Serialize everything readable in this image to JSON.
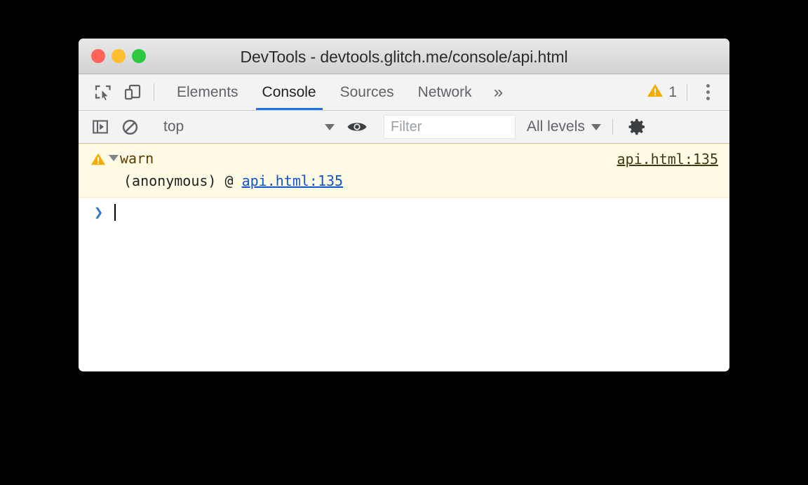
{
  "window": {
    "title": "DevTools - devtools.glitch.me/console/api.html",
    "traffic_lights": [
      {
        "name": "close",
        "color": "#ff6259"
      },
      {
        "name": "minimize",
        "color": "#ffbe2f"
      },
      {
        "name": "maximize",
        "color": "#2bc840"
      }
    ]
  },
  "tabstrip": {
    "inspect_icon": "inspect-element-icon",
    "device_icon": "device-toolbar-icon",
    "tabs": [
      {
        "label": "Elements",
        "active": false
      },
      {
        "label": "Console",
        "active": true
      },
      {
        "label": "Sources",
        "active": false
      },
      {
        "label": "Network",
        "active": false
      }
    ],
    "more_tabs_label": "»",
    "warning_count": "1",
    "warning_icon": "warning-triangle-icon",
    "menu_icon": "kebab-menu-icon"
  },
  "console_toolbar": {
    "sidebar_icon": "console-sidebar-icon",
    "clear_icon": "clear-console-icon",
    "context": {
      "value": "top",
      "options": [
        "top"
      ]
    },
    "eye_icon": "live-expression-eye-icon",
    "filter": {
      "value": "",
      "placeholder": "Filter"
    },
    "levels": {
      "value": "All levels",
      "options": [
        "All levels"
      ]
    },
    "settings_icon": "settings-gear-icon"
  },
  "console": {
    "messages": [
      {
        "level": "warning",
        "icon": "warning-triangle-icon",
        "expanded": true,
        "text": "warn",
        "source_link": "api.html:135",
        "stack": {
          "frame": "(anonymous) @ ",
          "link": "api.html:135"
        }
      }
    ],
    "prompt": {
      "chevron": "›",
      "value": ""
    }
  },
  "colors": {
    "accent_blue": "#1a73e8",
    "warning_bg": "#fffbe5",
    "warning_border": "#f5edbb",
    "warning_amber": "#f5ab00",
    "warn_text": "#5c3c00",
    "link_blue": "#1155cc"
  }
}
